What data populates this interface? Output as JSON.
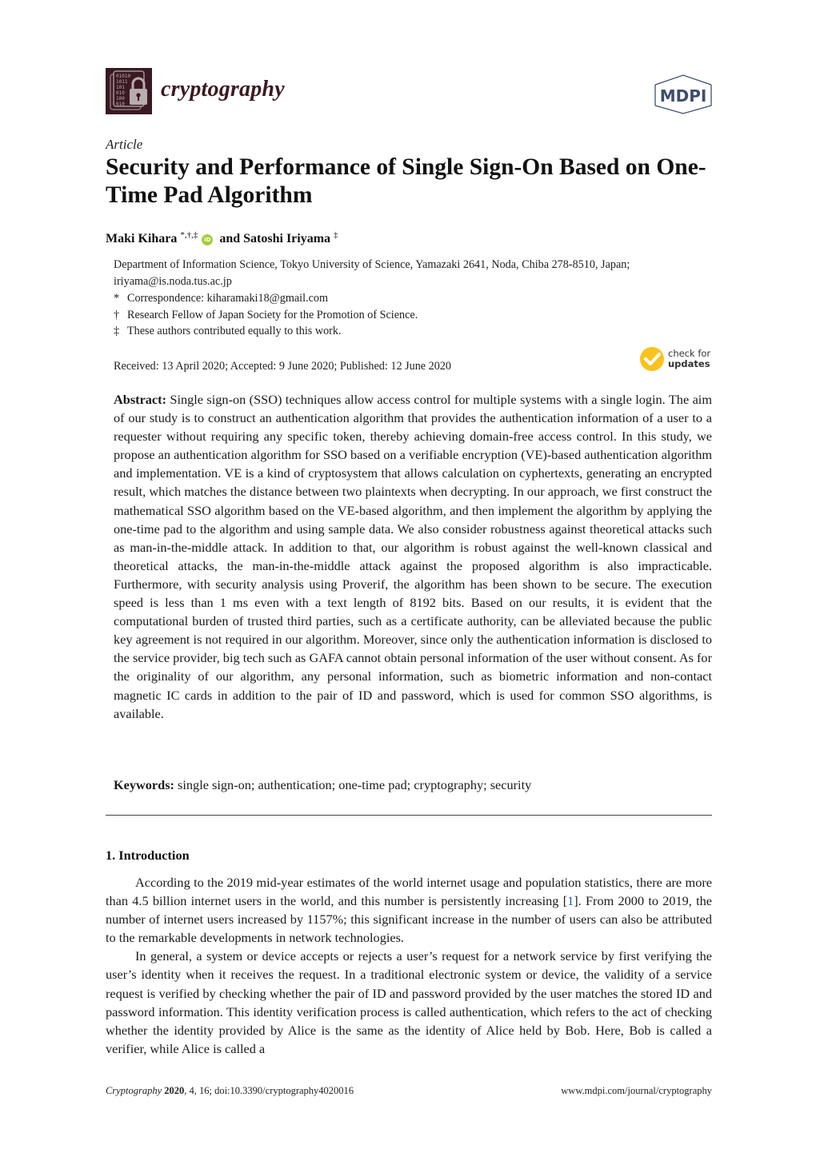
{
  "header": {
    "journal_name": "cryptography",
    "logo_binary_lines": [
      "01010",
      "1011",
      "101",
      "010",
      "100",
      "010"
    ],
    "publisher_logo_text": "MDPI",
    "journal_color": "#3a1a22"
  },
  "article": {
    "type": "Article",
    "title": "Security and Performance of Single Sign-On Based on One-Time Pad Algorithm",
    "authors": [
      {
        "name": "Maki Kihara",
        "marks": "*,†,‡",
        "orcid": true
      },
      {
        "connector": "and"
      },
      {
        "name": "Satoshi Iriyama",
        "marks": "‡",
        "orcid": false
      }
    ],
    "orcid_label": "iD",
    "affiliation_line1": "Department of Information Science, Tokyo University of Science, Yamazaki 2641, Noda, Chiba 278-8510, Japan;",
    "affiliation_line2": "iriyama@is.noda.tus.ac.jp",
    "notes": [
      {
        "mark": "*",
        "text": "Correspondence: kiharamaki18@gmail.com"
      },
      {
        "mark": "†",
        "text": "Research Fellow of Japan Society for the Promotion of Science."
      },
      {
        "mark": "‡",
        "text": "These authors contributed equally to this work."
      }
    ],
    "dates": "Received: 13 April 2020; Accepted: 9 June 2020; Published: 12 June 2020",
    "check_updates": {
      "line1": "check for",
      "line2": "updates",
      "color": "#f9c21e"
    },
    "abstract_label": "Abstract:",
    "abstract_text": "Single sign-on (SSO) techniques allow access control for multiple systems with a single login. The aim of our study is to construct an authentication algorithm that provides the authentication information of a user to a requester without requiring any specific token, thereby achieving domain-free access control. In this study, we propose an authentication algorithm for SSO based on a verifiable encryption (VE)-based authentication algorithm and implementation. VE is a kind of cryptosystem that allows calculation on cyphertexts, generating an encrypted result, which matches the distance between two plaintexts when decrypting. In our approach, we first construct the mathematical SSO algorithm based on the VE-based algorithm, and then implement the algorithm by applying the one-time pad to the algorithm and using sample data. We also consider robustness against theoretical attacks such as man-in-the-middle attack. In addition to that, our algorithm is robust against the well-known classical and theoretical attacks, the man-in-the-middle attack against the proposed algorithm is also impracticable. Furthermore, with security analysis using Proverif, the algorithm has been shown to be secure. The execution speed is less than 1 ms even with a text length of 8192 bits. Based on our results, it is evident that the computational burden of trusted third parties, such as a certificate authority, can be alleviated because the public key agreement is not required in our algorithm. Moreover, since only the authentication information is disclosed to the service provider, big tech such as GAFA cannot obtain personal information of the user without consent. As for the originality of our algorithm, any personal information, such as biometric information and non-contact magnetic IC cards in addition to the pair of ID and password, which is used for common SSO algorithms, is available.",
    "keywords_label": "Keywords:",
    "keywords_text": "single sign-on; authentication; one-time pad; cryptography; security"
  },
  "introduction": {
    "heading": "1. Introduction",
    "p1_before_cite": "According to the 2019 mid-year estimates of the world internet usage and population statistics, there are more than 4.5 billion internet users in the world, and this number is persistently increasing [",
    "p1_cite": "1",
    "p1_after_cite": "]. From 2000 to 2019, the number of internet users increased by 1157%; this significant increase in the number of users can also be attributed to the remarkable developments in network technologies.",
    "p2": "In general, a system or device accepts or rejects a user’s request for a network service by first verifying the user’s identity when it receives the request. In a traditional electronic system or device, the validity of a service request is verified by checking whether the pair of ID and password provided by the user matches the stored ID and password information. This identity verification process is called authentication, which refers to the act of checking whether the identity provided by Alice is the same as the identity of Alice held by Bob. Here, Bob is called a verifier, while Alice is called a",
    "cite_color": "#1a5ea8"
  },
  "footer": {
    "journal": "Cryptography",
    "year": "2020",
    "rest": ", 4, 16; doi:10.3390/cryptography4020016",
    "url": "www.mdpi.com/journal/cryptography"
  }
}
